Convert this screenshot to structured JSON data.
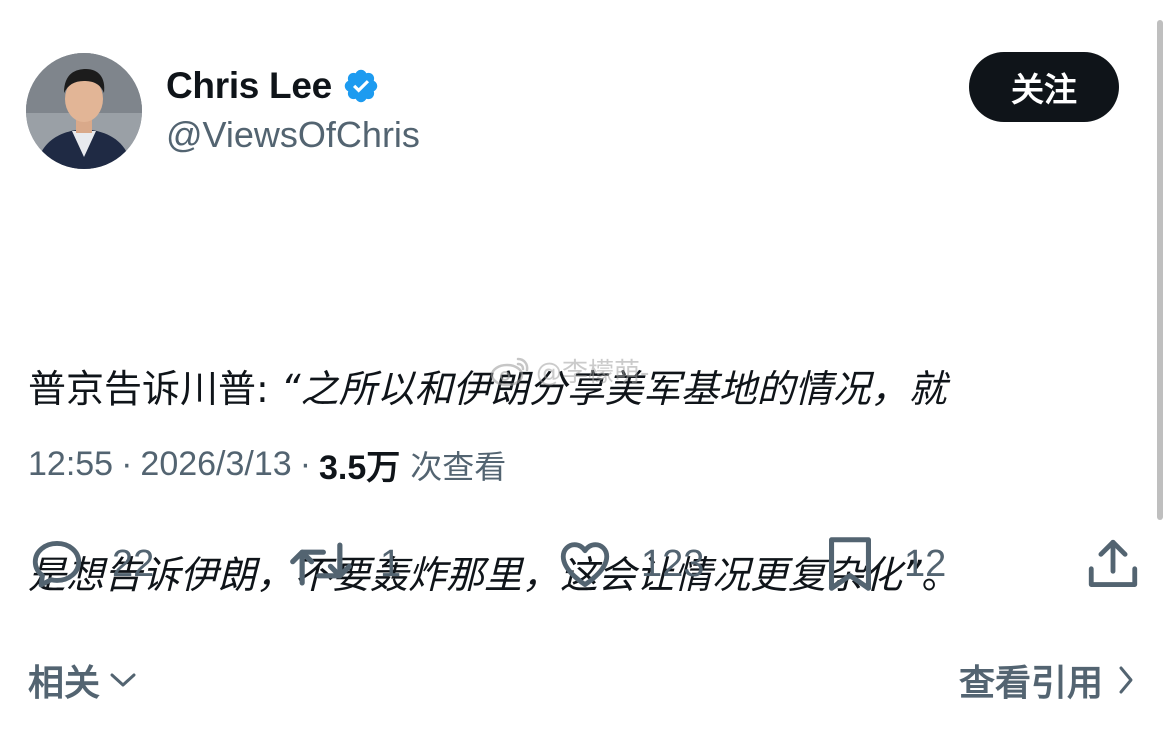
{
  "author": {
    "name": "Chris Lee",
    "handle": "@ViewsOfChris",
    "verified": true,
    "avatar": "man-in-suit-avatar"
  },
  "follow_button": {
    "label": "关注"
  },
  "tweet": {
    "lines": [
      {
        "prefix": "普京告诉川普: ",
        "quoted": "“之所以和伊朗分享美军基地的情况，就"
      },
      {
        "prefix": "",
        "quoted": "是想告诉伊朗，不要轰炸那里，这会让情况更复杂化”",
        "suffix": "。"
      }
    ]
  },
  "watermark": {
    "text": "@李檬萌-",
    "icon": "weibo-icon"
  },
  "meta": {
    "time": "12:55",
    "date": "2026/3/13",
    "views_count": "3.5万",
    "views_label": "次查看",
    "separator": "·"
  },
  "actions": {
    "reply": {
      "icon": "reply-icon",
      "count": "22"
    },
    "retweet": {
      "icon": "retweet-icon",
      "count": "1"
    },
    "like": {
      "icon": "heart-icon",
      "count": "123"
    },
    "bookmark": {
      "icon": "bookmark-icon",
      "count": "12"
    },
    "share": {
      "icon": "share-icon"
    }
  },
  "footer": {
    "related_label": "相关",
    "quotes_label": "查看引用"
  },
  "colors": {
    "text_primary": "#0f1419",
    "text_secondary": "#536471",
    "verified_blue": "#1d9bf0",
    "button_bg": "#0f1419"
  }
}
